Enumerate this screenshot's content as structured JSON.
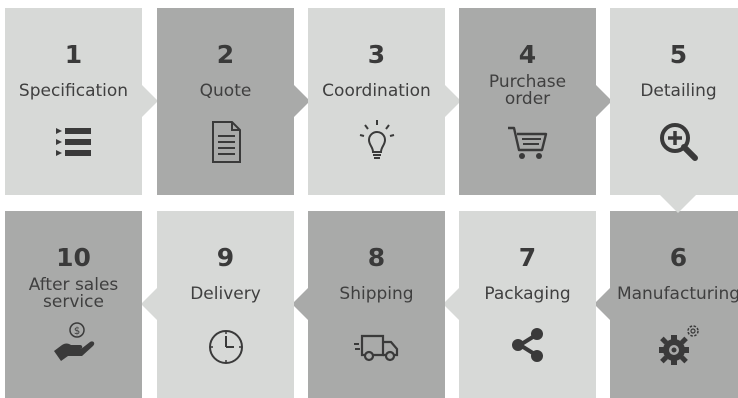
{
  "steps": [
    {
      "number": "1",
      "label": "Specification",
      "icon": "list-icon"
    },
    {
      "number": "2",
      "label": "Quote",
      "icon": "document-icon"
    },
    {
      "number": "3",
      "label": "Coordination",
      "icon": "lightbulb-icon"
    },
    {
      "number": "4",
      "label_line1": "Purchase",
      "label_line2": "order",
      "icon": "shopping-cart-icon"
    },
    {
      "number": "5",
      "label": "Detailing",
      "icon": "zoom-in-icon"
    },
    {
      "number": "6",
      "label": "Manufacturing",
      "icon": "gears-icon"
    },
    {
      "number": "7",
      "label": "Packaging",
      "icon": "share-icon"
    },
    {
      "number": "8",
      "label": "Shipping",
      "icon": "delivery-truck-icon"
    },
    {
      "number": "9",
      "label": "Delivery",
      "icon": "clock-icon"
    },
    {
      "number": "10",
      "label_line1": "After sales",
      "label_line2": "service",
      "icon": "hand-coin-icon",
      "icon_glyph": "$"
    }
  ],
  "colors": {
    "light_tile": "#d7d9d7",
    "dark_tile": "#a9aaa9",
    "text": "#3a3a3a"
  }
}
